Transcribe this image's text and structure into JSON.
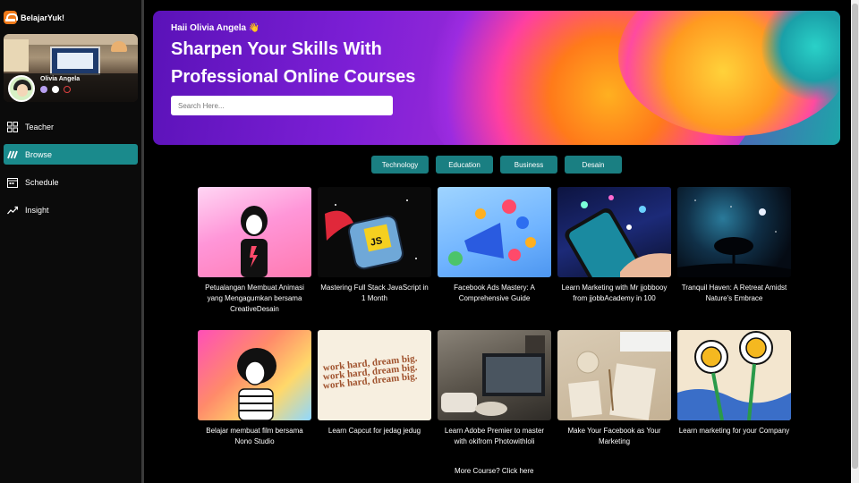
{
  "app": {
    "name": "BelajarYuk!"
  },
  "profile": {
    "name": "Olivia Angela"
  },
  "nav": [
    {
      "label": "Teacher",
      "icon": "dashboard-grid-icon"
    },
    {
      "label": "Browse",
      "icon": "browse-icon",
      "active": true
    },
    {
      "label": "Schedule",
      "icon": "calendar-icon"
    },
    {
      "label": "Insight",
      "icon": "trend-chart-icon"
    }
  ],
  "hero": {
    "greeting": "Haii Olivia Angela 👋",
    "title": "Sharpen Your Skills With Professional Online Courses",
    "search_placeholder": "Search Here..."
  },
  "categories": [
    "Technology",
    "Education",
    "Business",
    "Desain"
  ],
  "courses": [
    {
      "title": "Petualangan Membuat Animasi yang Mengagumkan bersama CreativeDesain"
    },
    {
      "title": "Mastering Full Stack JavaScript in 1 Month"
    },
    {
      "title": "Facebook Ads Mastery: A Comprehensive Guide"
    },
    {
      "title": "Learn Marketing with Mr jjobbooy from jjobbAcademy in 100"
    },
    {
      "title": "Tranquil Haven: A Retreat Amidst Nature's Embrace"
    },
    {
      "title": "Belajar membuat film bersama Nono Studio"
    },
    {
      "title": "Learn Capcut for jedag jedug"
    },
    {
      "title": "Learn Adobe Premier to master with okifrom Photowithloli"
    },
    {
      "title": "Make Your Facebook as Your Marketing"
    },
    {
      "title": "Learn marketing for your Company"
    }
  ],
  "thumb_text": {
    "workhard": "work hard, dream big."
  },
  "more_link": "More Course? Click here",
  "colors": {
    "accent": "#1a8a8c",
    "hero_start": "#5a12b8",
    "sidebar": "#0b0b0b"
  }
}
